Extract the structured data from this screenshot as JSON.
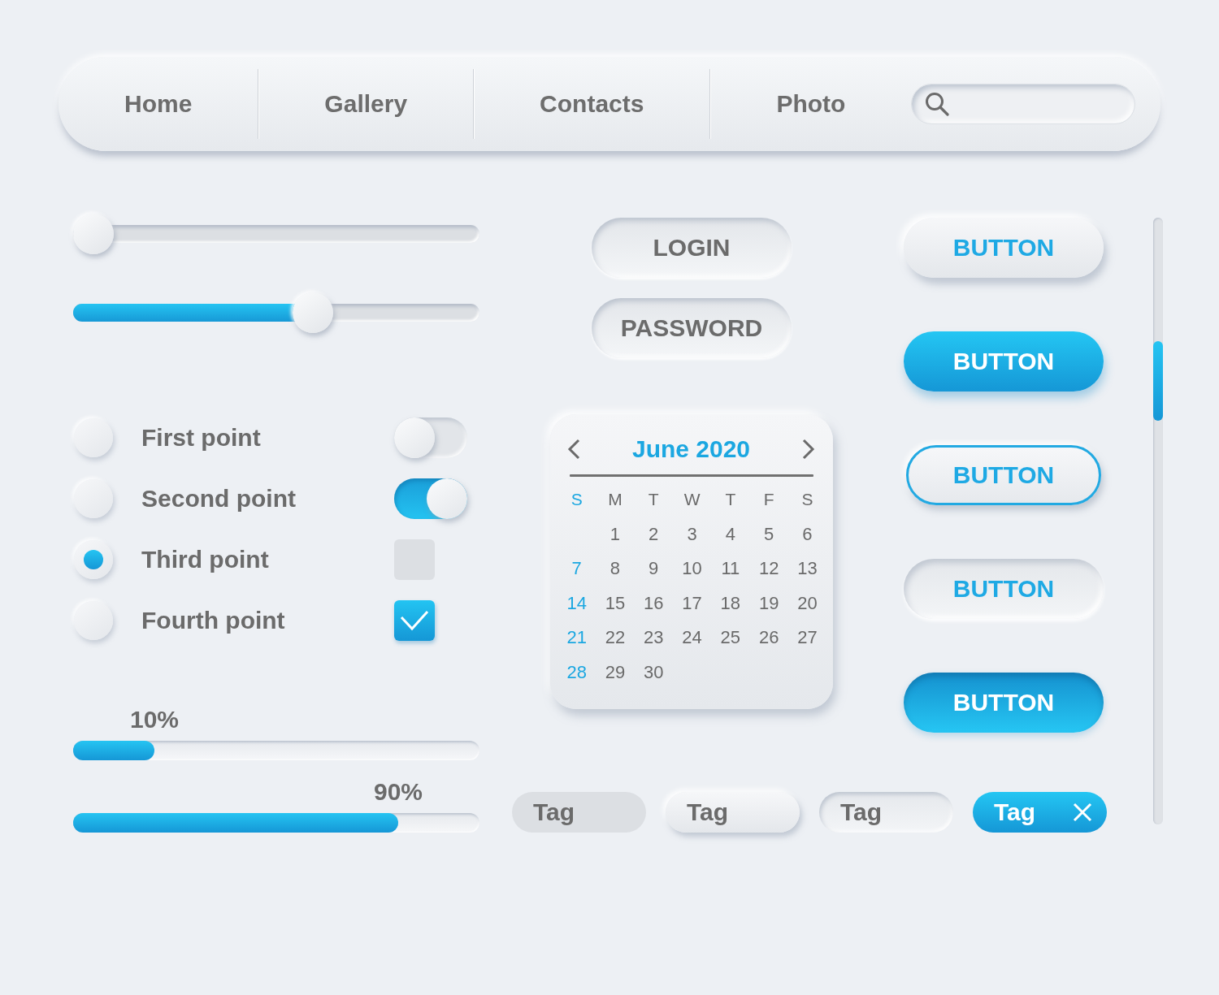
{
  "navbar": {
    "tabs": [
      "Home",
      "Gallery",
      "Contacts",
      "Photo"
    ]
  },
  "sliders": [
    {
      "level": 0
    },
    {
      "level": 0.6
    }
  ],
  "options": [
    {
      "label": "First point",
      "selected": false,
      "control": {
        "kind": "toggle",
        "on": false
      }
    },
    {
      "label": "Second point",
      "selected": false,
      "control": {
        "kind": "toggle",
        "on": true
      }
    },
    {
      "label": "Third point",
      "selected": true,
      "control": {
        "kind": "checkbox",
        "checked": false
      }
    },
    {
      "label": "Fourth point",
      "selected": false,
      "control": {
        "kind": "checkbox",
        "checked": true
      }
    }
  ],
  "progress_bars": [
    {
      "reading": "10%",
      "level": 0.2
    },
    {
      "reading": "90%",
      "level": 0.8
    }
  ],
  "login_form": {
    "fields": [
      {
        "placeholder": "LOGIN"
      },
      {
        "placeholder": "PASSWORD"
      }
    ]
  },
  "calendar": {
    "title": "June 2020",
    "weekdays": [
      {
        "label": "S",
        "color": "#1ba7e1"
      },
      {
        "label": "M",
        "color": "#6a6a6a"
      },
      {
        "label": "T",
        "color": "#6a6a6a"
      },
      {
        "label": "W",
        "color": "#6a6a6a"
      },
      {
        "label": "T",
        "color": "#6a6a6a"
      },
      {
        "label": "F",
        "color": "#6a6a6a"
      },
      {
        "label": "S",
        "color": "#6a6a6a"
      }
    ],
    "weeks": [
      [
        "1",
        "2",
        "3",
        "4",
        "5",
        "6"
      ],
      [
        "7",
        "8",
        "9",
        "10",
        "11",
        "12",
        "13"
      ],
      [
        "14",
        "15",
        "16",
        "17",
        "18",
        "19",
        "20"
      ],
      [
        "21",
        "22",
        "23",
        "24",
        "25",
        "26",
        "27"
      ],
      [
        "28",
        "29",
        "30"
      ]
    ]
  },
  "buttons": [
    {
      "label": "BUTTON",
      "kind": "raised"
    },
    {
      "label": "BUTTON",
      "kind": "filled"
    },
    {
      "label": "BUTTON",
      "kind": "outlined"
    },
    {
      "label": "BUTTON",
      "kind": "inset"
    },
    {
      "label": "BUTTON",
      "kind": "pressed"
    }
  ],
  "tags": [
    {
      "label": "Tag",
      "kind": "flat",
      "removable": false
    },
    {
      "label": "Tag",
      "kind": "raised",
      "removable": false
    },
    {
      "label": "Tag",
      "kind": "inset",
      "removable": false
    },
    {
      "label": "Tag",
      "kind": "filled",
      "removable": true
    }
  ]
}
